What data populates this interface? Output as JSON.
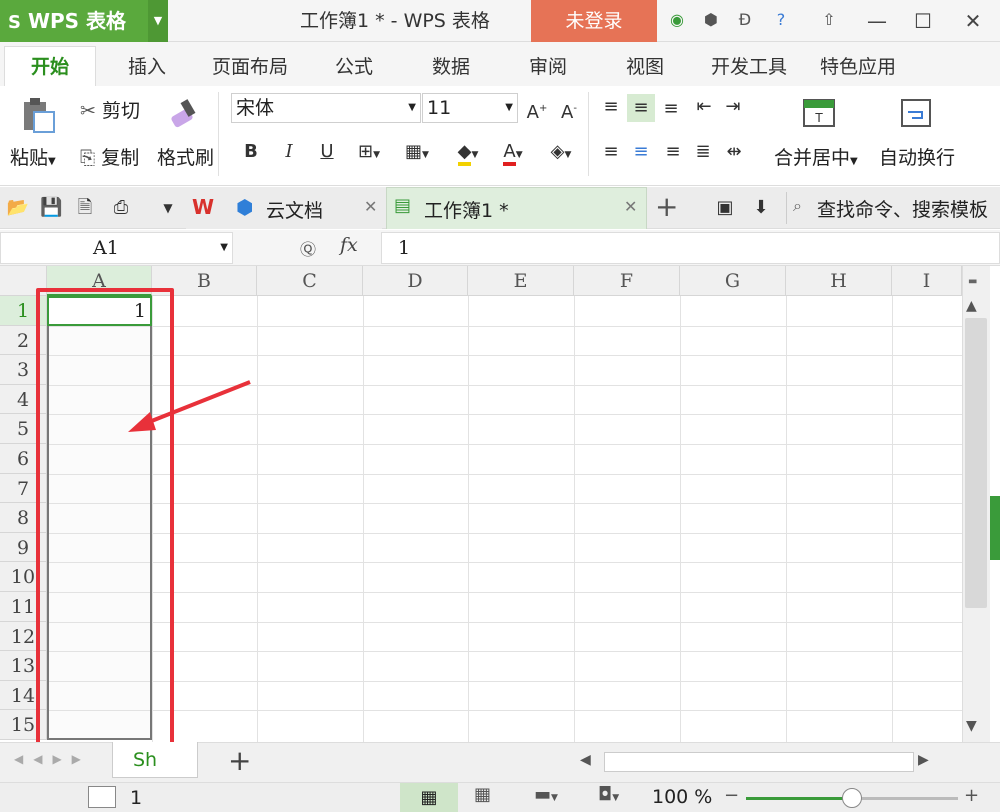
{
  "titlebar": {
    "app_name": "WPS 表格",
    "window_title": "工作簿1 * - WPS 表格",
    "login_label": "未登录",
    "minimize": "—",
    "maximize": "☐",
    "close": "✕"
  },
  "ribbon_tabs": [
    "开始",
    "插入",
    "页面布局",
    "公式",
    "数据",
    "审阅",
    "视图",
    "开发工具",
    "特色应用"
  ],
  "clipboard": {
    "paste": "粘贴",
    "cut": "剪切",
    "copy": "复制",
    "format_painter": "格式刷"
  },
  "font": {
    "name": "宋体",
    "size": "11",
    "bold": "B",
    "italic": "I",
    "underline": "U"
  },
  "alignment": {
    "merge_center": "合并居中",
    "wrap_text": "自动换行"
  },
  "doc_tabs": {
    "cloud_docs": "云文档",
    "workbook": "工作簿1 *",
    "search_placeholder": "查找命令、搜索模板"
  },
  "formula_bar": {
    "cell_ref": "A1",
    "fx_label": "fx",
    "value": "1"
  },
  "sheet": {
    "columns": [
      "A",
      "B",
      "C",
      "D",
      "E",
      "F",
      "G",
      "H",
      "I"
    ],
    "rows": [
      "1",
      "2",
      "3",
      "4",
      "5",
      "6",
      "7",
      "8",
      "9",
      "10",
      "11",
      "12",
      "13",
      "14",
      "15"
    ],
    "cell_A1": "1"
  },
  "sheet_tabs": {
    "active_tab": "Sh",
    "add_label": "+"
  },
  "status": {
    "value": "1",
    "zoom": "100 %"
  },
  "colors": {
    "brand_green": "#5aa93d",
    "login_orange": "#e67356",
    "highlight_red": "#e8313a"
  }
}
